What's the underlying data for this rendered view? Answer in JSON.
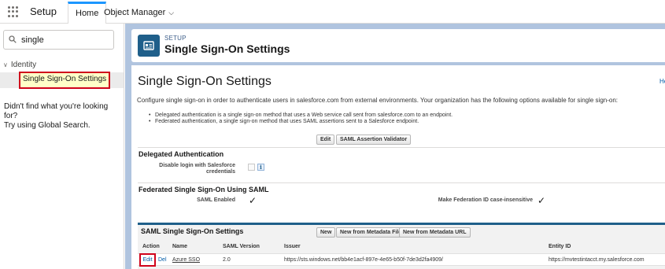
{
  "topbar": {
    "app_name": "Setup",
    "tabs": [
      {
        "label": "Home"
      },
      {
        "label": "Object Manager"
      }
    ]
  },
  "sidebar": {
    "search": {
      "value": "single",
      "placeholder": ""
    },
    "tree": {
      "category": "Identity",
      "item": "Single Sign-On Settings"
    },
    "not_found_line1": "Didn't find what you're looking for?",
    "not_found_line2": "Try using Global Search."
  },
  "header": {
    "small_label": "SETUP",
    "title": "Single Sign-On Settings"
  },
  "content": {
    "page_title": "Single Sign-On Settings",
    "help_link": "He",
    "description": "Configure single sign-on in order to authenticate users in salesforce.com from external environments. Your organization has the following options available for single sign-on:",
    "bullets": [
      "Delegated authentication is a single sign-on method that uses a Web service call sent from salesforce.com to an endpoint.",
      "Federated authentication, a single sign-on method that uses SAML assertions sent to a Salesforce endpoint."
    ],
    "top_buttons": {
      "edit": "Edit",
      "validator": "SAML Assertion Validator"
    },
    "delegated": {
      "title": "Delegated Authentication",
      "field_label_line1": "Disable login with Salesforce",
      "field_label_line2": "credentials",
      "info": "i"
    },
    "federated": {
      "title": "Federated Single Sign-On Using SAML",
      "saml_enabled_label": "SAML Enabled",
      "saml_enabled_check": "✓",
      "case_insensitive_label": "Make Federation ID case-insensitive",
      "case_insensitive_check": "✓"
    },
    "saml": {
      "title": "SAML Single Sign-On Settings",
      "buttons": {
        "new": "New",
        "from_file": "New from Metadata File",
        "from_url": "New from Metadata URL"
      },
      "columns": [
        "Action",
        "Name",
        "SAML Version",
        "Issuer",
        "Entity ID"
      ],
      "row": {
        "edit": "Edit",
        "del": "Del",
        "name": "Azure SSO",
        "version": "2.0",
        "issuer": "https://sts.windows.net/bb4e1acf-897e-4e65-b50f-7de3d2fa4909/",
        "entity_id": "https://mvtestintacct.my.salesforce.com"
      }
    }
  },
  "colors": {
    "accent_blue": "#1b96ff",
    "header_icon": "#1f5f8a",
    "highlight_outline": "#d0021b",
    "main_background": "#b0c4df"
  }
}
